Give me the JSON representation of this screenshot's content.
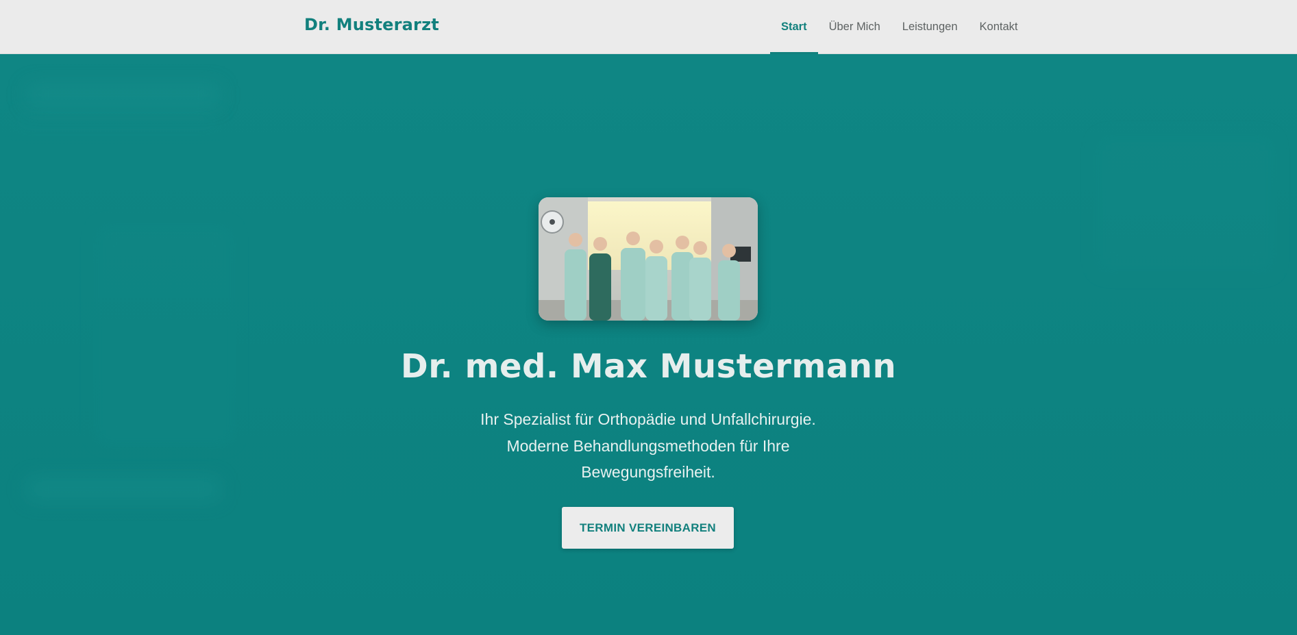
{
  "header": {
    "logo": "Dr. Musterarzt",
    "nav": [
      {
        "label": "Start",
        "active": true
      },
      {
        "label": "Über Mich",
        "active": false
      },
      {
        "label": "Leistungen",
        "active": false
      },
      {
        "label": "Kontakt",
        "active": false
      }
    ]
  },
  "hero": {
    "image_icon": "team-photo",
    "name": "Dr. med. Max Mustermann",
    "subtitle_lines": [
      "Ihr Spezialist für Orthopädie und Unfallchirurgie.",
      "Moderne Behandlungsmethoden für Ihre",
      "Bewegungsfreiheit."
    ],
    "cta_label": "TERMIN VEREINBAREN"
  },
  "colors": {
    "brand": "#12807d",
    "hero_background": "#0f8482",
    "header_background": "#ebebeb",
    "hero_text": "#e6eeed"
  }
}
